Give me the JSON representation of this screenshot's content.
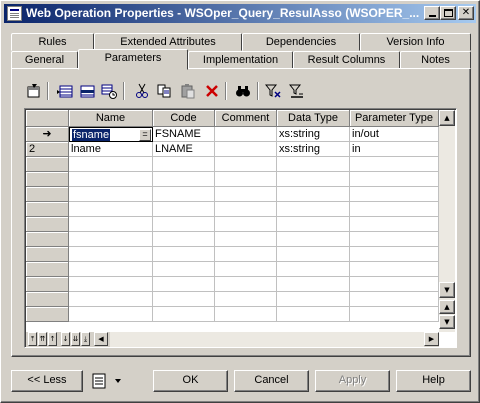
{
  "window": {
    "title": "Web Operation Properties - WSOper_Query_ResulAsso (WSOPER_..."
  },
  "tabs_row1": [
    "Rules",
    "Extended Attributes",
    "Dependencies",
    "Version Info"
  ],
  "tabs_row2": [
    "General",
    "Parameters",
    "Implementation",
    "Result Columns",
    "Notes"
  ],
  "active_tab": "Parameters",
  "toolbar": {
    "icons": [
      "properties-icon",
      "add-row-icon",
      "insert-row-icon",
      "add-rows-icon",
      "cut-icon",
      "copy-icon",
      "paste-icon",
      "delete-icon",
      "find-icon",
      "filter-icon",
      "clear-filter-icon"
    ]
  },
  "table": {
    "columns": [
      "Name",
      "Code",
      "Comment",
      "Data Type",
      "Parameter Type"
    ],
    "rows": [
      {
        "marker": "➜",
        "name": "fsname",
        "code": "FSNAME",
        "comment": "",
        "data_type": "xs:string",
        "parameter_type": "in/out"
      },
      {
        "marker": "2",
        "name": "lname",
        "code": "LNAME",
        "comment": "",
        "data_type": "xs:string",
        "parameter_type": "in"
      }
    ],
    "ellipsis": "="
  },
  "buttons": {
    "less": "<< Less",
    "ok": "OK",
    "cancel": "Cancel",
    "apply": "Apply",
    "help": "Help"
  },
  "colors": {
    "title_start": "#0a246a",
    "title_end": "#a6caf0",
    "face": "#d4d0c8",
    "selection": "#0a246a"
  }
}
